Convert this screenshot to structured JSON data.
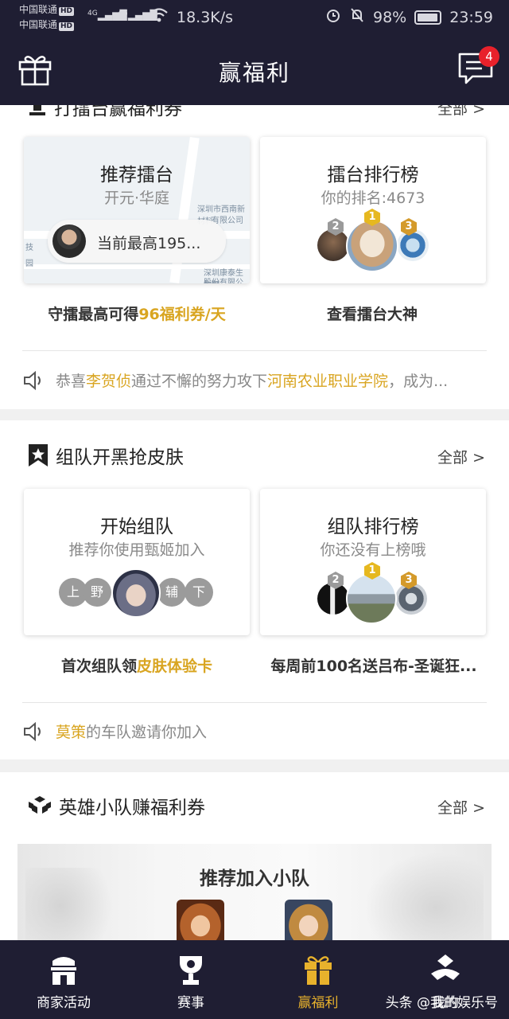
{
  "status_bar": {
    "carrier1": "中国联通",
    "carrier2": "中国联通",
    "hd": "HD",
    "net1": "4G",
    "net2": "4G",
    "speed": "18.3K/s",
    "battery": "98%",
    "time": "23:59"
  },
  "header": {
    "title": "赢福利",
    "message_count": "4"
  },
  "arena": {
    "title_partial": "打擂台赢福利券",
    "all_label": "全部 >",
    "left_card": {
      "title": "推荐擂台",
      "subtitle": "开元·华庭",
      "pill_text": "当前最高195...",
      "map_label_1": "深圳市西南新材料",
      "map_label_2": "有限公司",
      "map_label_3": "深圳康泰生物制",
      "map_label_4": "股份有限公司",
      "map_label_5": "技",
      "map_label_6": "园"
    },
    "right_card": {
      "title": "擂台排行榜",
      "subtitle": "你的排名:4673",
      "ranks": [
        "1",
        "2",
        "3"
      ]
    },
    "caption_left_prefix": "守擂最高可得",
    "caption_left_highlight": "96福利券/天",
    "caption_right": "查看擂台大神",
    "notice": {
      "part1": "恭喜",
      "name": "李贺侦",
      "part2": "通过不懈的努力攻下",
      "school": "河南农业职业学院",
      "part3": "，成为..."
    }
  },
  "team": {
    "title": "组队开黑抢皮肤",
    "all_label": "全部 >",
    "left_card": {
      "title": "开始组队",
      "subtitle": "推荐你使用甄姬加入",
      "positions": [
        "上",
        "野",
        "辅",
        "下"
      ]
    },
    "right_card": {
      "title": "组队排行榜",
      "subtitle": "你还没有上榜哦",
      "ranks": [
        "1",
        "2",
        "3"
      ]
    },
    "caption_left_prefix": "首次组队领",
    "caption_left_highlight": "皮肤体验卡",
    "caption_right": "每周前100名送吕布-圣诞狂...",
    "notice": {
      "name": "莫策",
      "text": "的车队邀请你加入"
    }
  },
  "squad": {
    "title": "英雄小队赚福利券",
    "all_label": "全部 >",
    "recommend": "推荐加入小队"
  },
  "bottom_nav": {
    "items": [
      {
        "label": "商家活动",
        "icon": "shop-icon"
      },
      {
        "label": "赛事",
        "icon": "trophy-icon"
      },
      {
        "label": "赢福利",
        "icon": "gift-icon"
      },
      {
        "label": "我的",
        "icon": "profile-icon"
      }
    ],
    "active_index": 2,
    "watermark": "头条 @我的娱乐号"
  },
  "colors": {
    "dark_bg": "#1f1e33",
    "highlight": "#d9a521",
    "active_nav": "#e8b22c",
    "badge": "#e8212b"
  }
}
